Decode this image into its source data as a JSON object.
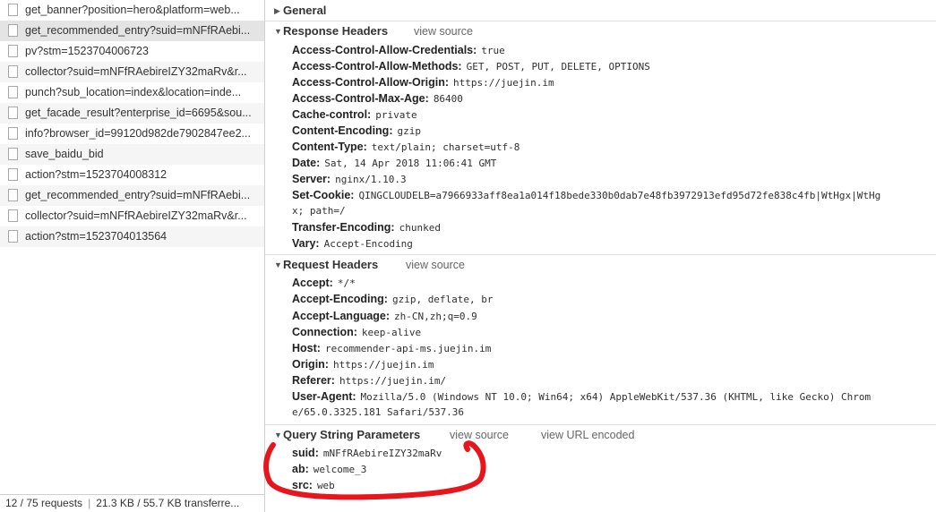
{
  "requests": [
    {
      "name": "get_banner?position=hero&platform=web..."
    },
    {
      "name": "get_recommended_entry?suid=mNFfRAebi..."
    },
    {
      "name": "pv?stm=1523704006723"
    },
    {
      "name": "collector?suid=mNFfRAebireIZY32maRv&r..."
    },
    {
      "name": "punch?sub_location=index&location=inde..."
    },
    {
      "name": "get_facade_result?enterprise_id=6695&sou..."
    },
    {
      "name": "info?browser_id=99120d982de7902847ee2..."
    },
    {
      "name": "save_baidu_bid"
    },
    {
      "name": "action?stm=1523704008312"
    },
    {
      "name": "get_recommended_entry?suid=mNFfRAebi..."
    },
    {
      "name": "collector?suid=mNFfRAebireIZY32maRv&r..."
    },
    {
      "name": "action?stm=1523704013564"
    }
  ],
  "status": {
    "requests": "12 / 75 requests",
    "transfer": "21.3 KB / 55.7 KB transferre..."
  },
  "general": {
    "title": "General"
  },
  "response_headers": {
    "title": "Response Headers",
    "view_source": "view source",
    "items": [
      {
        "key": "Access-Control-Allow-Credentials:",
        "value": "true"
      },
      {
        "key": "Access-Control-Allow-Methods:",
        "value": "GET, POST, PUT, DELETE, OPTIONS"
      },
      {
        "key": "Access-Control-Allow-Origin:",
        "value": "https://juejin.im"
      },
      {
        "key": "Access-Control-Max-Age:",
        "value": "86400"
      },
      {
        "key": "Cache-control:",
        "value": "private"
      },
      {
        "key": "Content-Encoding:",
        "value": "gzip"
      },
      {
        "key": "Content-Type:",
        "value": "text/plain; charset=utf-8"
      },
      {
        "key": "Date:",
        "value": "Sat, 14 Apr 2018 11:06:41 GMT"
      },
      {
        "key": "Server:",
        "value": "nginx/1.10.3"
      },
      {
        "key": "Set-Cookie:",
        "value": "QINGCLOUDELB=a7966933aff8ea1a014f18bede330b0dab7e48fb3972913efd95d72fe838c4fb|WtHgx|WtHg"
      },
      {
        "key": "Transfer-Encoding:",
        "value": "chunked"
      },
      {
        "key": "Vary:",
        "value": "Accept-Encoding"
      }
    ],
    "set_cookie_cont": "x; path=/"
  },
  "request_headers": {
    "title": "Request Headers",
    "view_source": "view source",
    "items": [
      {
        "key": "Accept:",
        "value": "*/*"
      },
      {
        "key": "Accept-Encoding:",
        "value": "gzip, deflate, br"
      },
      {
        "key": "Accept-Language:",
        "value": "zh-CN,zh;q=0.9"
      },
      {
        "key": "Connection:",
        "value": "keep-alive"
      },
      {
        "key": "Host:",
        "value": "recommender-api-ms.juejin.im"
      },
      {
        "key": "Origin:",
        "value": "https://juejin.im"
      },
      {
        "key": "Referer:",
        "value": "https://juejin.im/"
      },
      {
        "key": "User-Agent:",
        "value": "Mozilla/5.0 (Windows NT 10.0; Win64; x64) AppleWebKit/537.36 (KHTML, like Gecko) Chrom"
      }
    ],
    "user_agent_cont": "e/65.0.3325.181 Safari/537.36"
  },
  "query_string": {
    "title": "Query String Parameters",
    "view_source": "view source",
    "view_url_encoded": "view URL encoded",
    "items": [
      {
        "key": "suid:",
        "value": "mNFfRAebireIZY32maRv"
      },
      {
        "key": "ab:",
        "value": "welcome_3"
      },
      {
        "key": "src:",
        "value": "web"
      }
    ]
  },
  "colors": {
    "annotation": "#e8161c",
    "link": "#666666"
  }
}
